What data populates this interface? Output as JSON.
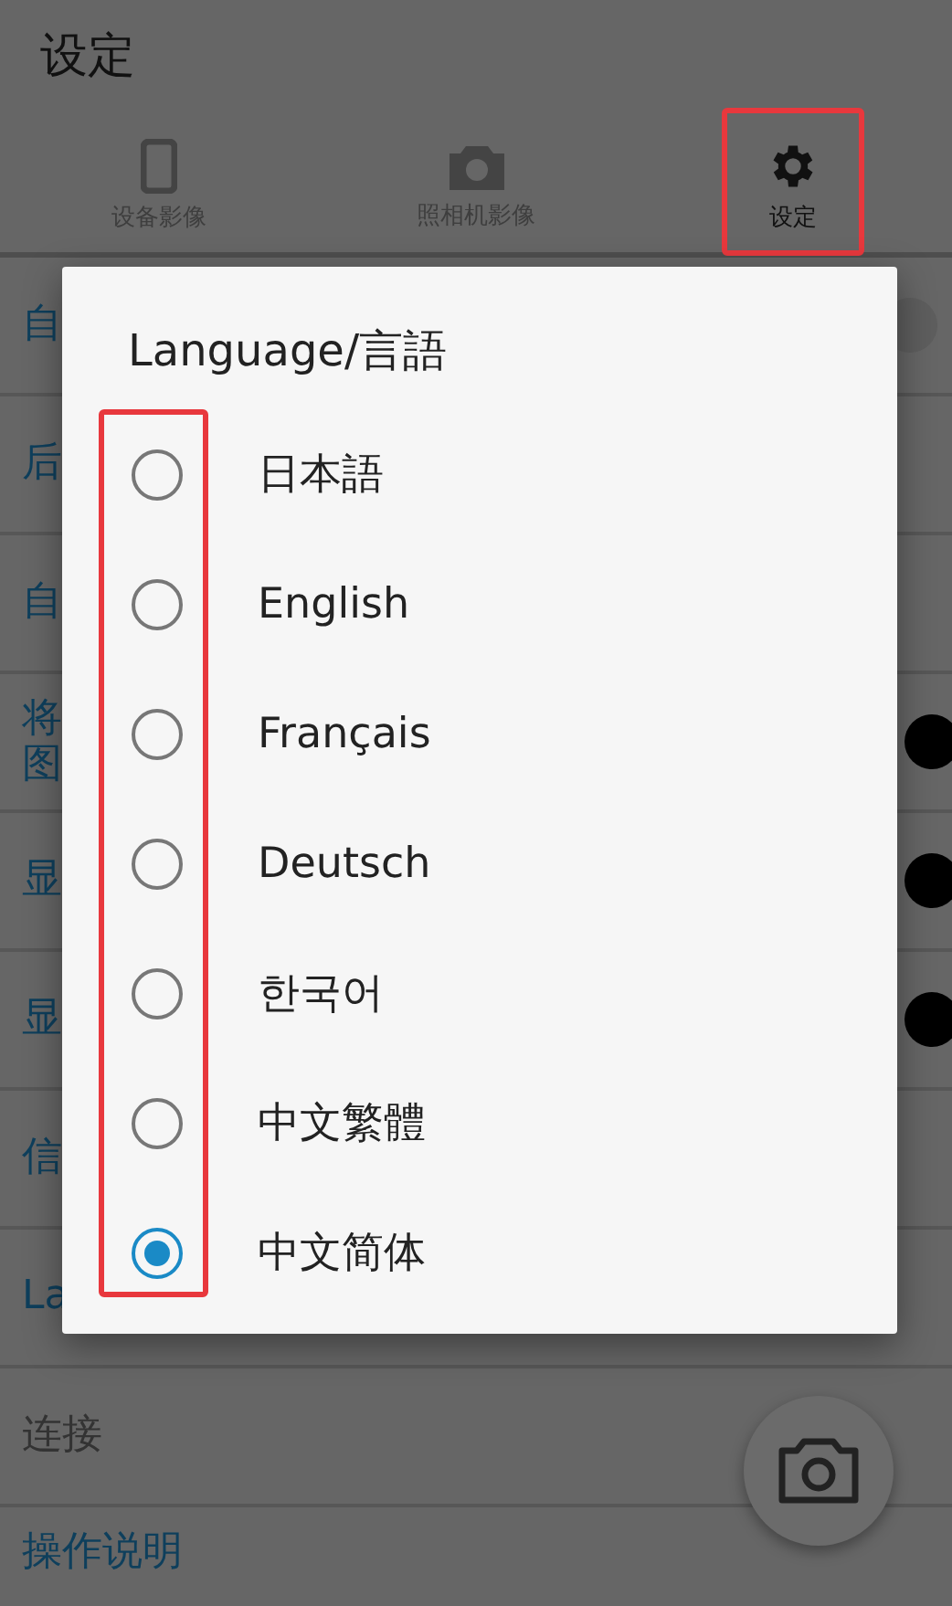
{
  "app_bar": {
    "title": "设定"
  },
  "tabs": [
    {
      "label": "设备影像",
      "kind": "phone",
      "selected": false,
      "highlighted": false
    },
    {
      "label": "照相机影像",
      "kind": "camera",
      "selected": false,
      "highlighted": false
    },
    {
      "label": "设定",
      "kind": "gear",
      "selected": true,
      "highlighted": true
    }
  ],
  "settings": [
    {
      "lines": [
        "自"
      ],
      "enabled": true,
      "switch": {
        "on": false
      }
    },
    {
      "lines": [
        "后"
      ],
      "enabled": true
    },
    {
      "lines": [
        "自"
      ],
      "enabled": true
    },
    {
      "lines": [
        "将",
        "图"
      ],
      "enabled": true,
      "switch": {
        "on": true
      }
    },
    {
      "lines": [
        "显"
      ],
      "enabled": true,
      "switch": {
        "on": true
      }
    },
    {
      "lines": [
        "显"
      ],
      "enabled": true,
      "switch": {
        "on": true
      }
    },
    {
      "lines": [
        "信"
      ],
      "enabled": true
    },
    {
      "lines": [
        "La"
      ],
      "enabled": true
    },
    {
      "lines": [
        "连接"
      ],
      "enabled": false
    },
    {
      "lines": [
        "操作说明"
      ],
      "enabled": true
    }
  ],
  "dialog": {
    "title": "Language/言語",
    "radios_highlighted": true,
    "options": [
      {
        "label": "日本語",
        "selected": false
      },
      {
        "label": "English",
        "selected": false
      },
      {
        "label": "Français",
        "selected": false
      },
      {
        "label": "Deutsch",
        "selected": false
      },
      {
        "label": "한국어",
        "selected": false
      },
      {
        "label": "中文繁體",
        "selected": false
      },
      {
        "label": "中文简体",
        "selected": true
      }
    ]
  }
}
